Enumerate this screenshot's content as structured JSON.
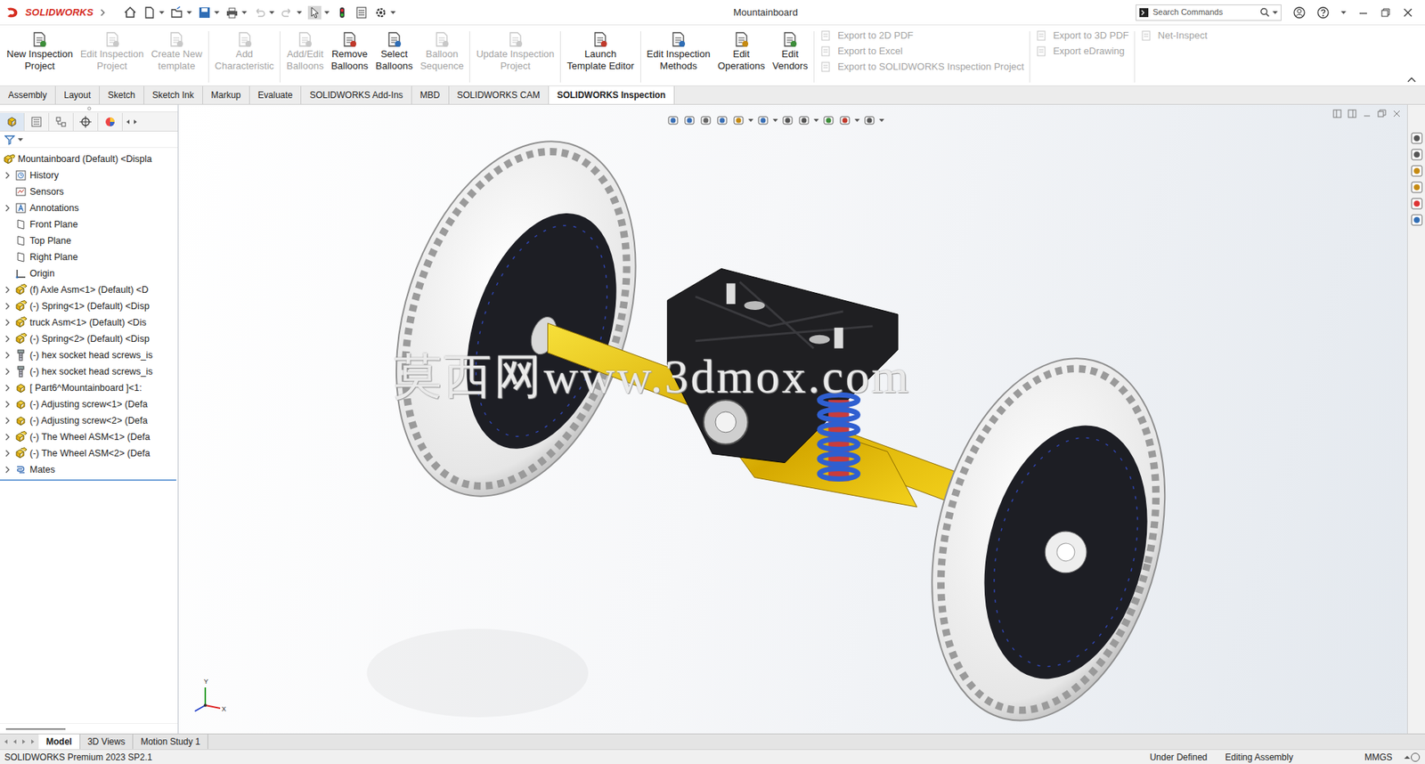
{
  "window": {
    "title": "Mountainboard"
  },
  "app": {
    "brand": "SOLIDWORKS"
  },
  "search": {
    "placeholder": "Search Commands"
  },
  "ribbon": {
    "groups": [
      [
        {
          "lines": [
            "New Inspection",
            "Project"
          ],
          "disabled": false
        },
        {
          "lines": [
            "Edit Inspection",
            "Project"
          ],
          "disabled": true
        },
        {
          "lines": [
            "Create New",
            "template"
          ],
          "disabled": true
        }
      ],
      [
        {
          "lines": [
            "Add",
            "Characteristic"
          ],
          "disabled": true
        }
      ],
      [
        {
          "lines": [
            "Add/Edit",
            "Balloons"
          ],
          "disabled": true
        },
        {
          "lines": [
            "Remove",
            "Balloons"
          ],
          "disabled": false
        },
        {
          "lines": [
            "Select",
            "Balloons"
          ],
          "disabled": false
        },
        {
          "lines": [
            "Balloon",
            "Sequence"
          ],
          "disabled": true
        }
      ],
      [
        {
          "lines": [
            "Update Inspection",
            "Project"
          ],
          "disabled": true
        }
      ],
      [
        {
          "lines": [
            "Launch",
            "Template Editor"
          ],
          "disabled": false
        }
      ],
      [
        {
          "lines": [
            "Edit Inspection",
            "Methods"
          ],
          "disabled": false
        },
        {
          "lines": [
            "Edit",
            "Operations"
          ],
          "disabled": false
        },
        {
          "lines": [
            "Edit",
            "Vendors"
          ],
          "disabled": false
        }
      ]
    ],
    "exports": [
      [
        {
          "label": "Export to 2D PDF",
          "disabled": true
        },
        {
          "label": "Export to Excel",
          "disabled": true
        },
        {
          "label": "Export to SOLIDWORKS Inspection Project",
          "disabled": true
        }
      ],
      [
        {
          "label": "Export to 3D PDF",
          "disabled": true
        },
        {
          "label": "Export eDrawing",
          "disabled": true
        }
      ],
      [
        {
          "label": "Net-Inspect",
          "disabled": true
        }
      ]
    ]
  },
  "tabs": [
    {
      "label": "Assembly",
      "selected": false
    },
    {
      "label": "Layout",
      "selected": false
    },
    {
      "label": "Sketch",
      "selected": false
    },
    {
      "label": "Sketch Ink",
      "selected": false
    },
    {
      "label": "Markup",
      "selected": false
    },
    {
      "label": "Evaluate",
      "selected": false
    },
    {
      "label": "SOLIDWORKS Add-Ins",
      "selected": false
    },
    {
      "label": "MBD",
      "selected": false
    },
    {
      "label": "SOLIDWORKS CAM",
      "selected": false
    },
    {
      "label": "SOLIDWORKS Inspection",
      "selected": true
    }
  ],
  "tree": {
    "items": [
      {
        "label": "Mountainboard (Default) <Displa",
        "kind": "root",
        "expandable": false
      },
      {
        "label": "History",
        "kind": "history",
        "expandable": true
      },
      {
        "label": "Sensors",
        "kind": "sensors",
        "expandable": false
      },
      {
        "label": "Annotations",
        "kind": "annotations",
        "expandable": true
      },
      {
        "label": "Front Plane",
        "kind": "plane",
        "expandable": false
      },
      {
        "label": "Top Plane",
        "kind": "plane",
        "expandable": false
      },
      {
        "label": "Right Plane",
        "kind": "plane",
        "expandable": false
      },
      {
        "label": "Origin",
        "kind": "origin",
        "expandable": false
      },
      {
        "label": "(f) Axle Asm<1> (Default) <D",
        "kind": "assembly",
        "expandable": true
      },
      {
        "label": "(-) Spring<1> (Default) <Disp",
        "kind": "assembly",
        "expandable": true
      },
      {
        "label": "truck Asm<1> (Default) <Dis",
        "kind": "assembly",
        "expandable": true
      },
      {
        "label": "(-) Spring<2> (Default) <Disp",
        "kind": "assembly",
        "expandable": true
      },
      {
        "label": "(-) hex socket head screws_is",
        "kind": "screw",
        "expandable": true
      },
      {
        "label": "(-) hex socket head screws_is",
        "kind": "screw",
        "expandable": true
      },
      {
        "label": "[ Part6^Mountainboard ]<1:",
        "kind": "part",
        "expandable": true
      },
      {
        "label": "(-) Adjusting screw<1> (Defa",
        "kind": "part",
        "expandable": true
      },
      {
        "label": "(-) Adjusting screw<2> (Defa",
        "kind": "part",
        "expandable": true
      },
      {
        "label": "(-) The Wheel ASM<1> (Defa",
        "kind": "assembly",
        "expandable": true
      },
      {
        "label": "(-) The Wheel ASM<2> (Defa",
        "kind": "assembly",
        "expandable": true
      },
      {
        "label": "Mates",
        "kind": "mates",
        "expandable": true
      }
    ]
  },
  "viewport": {
    "watermark": "莫西网www.3dmox.com",
    "triad": [
      "Y",
      "X"
    ]
  },
  "bottom_tabs": [
    {
      "label": "Model",
      "selected": true
    },
    {
      "label": "3D Views",
      "selected": false
    },
    {
      "label": "Motion Study 1",
      "selected": false
    }
  ],
  "status_bar": {
    "left": "SOLIDWORKS Premium 2023 SP2.1",
    "items": [
      "Under Defined",
      "Editing Assembly",
      "MMGS"
    ]
  }
}
